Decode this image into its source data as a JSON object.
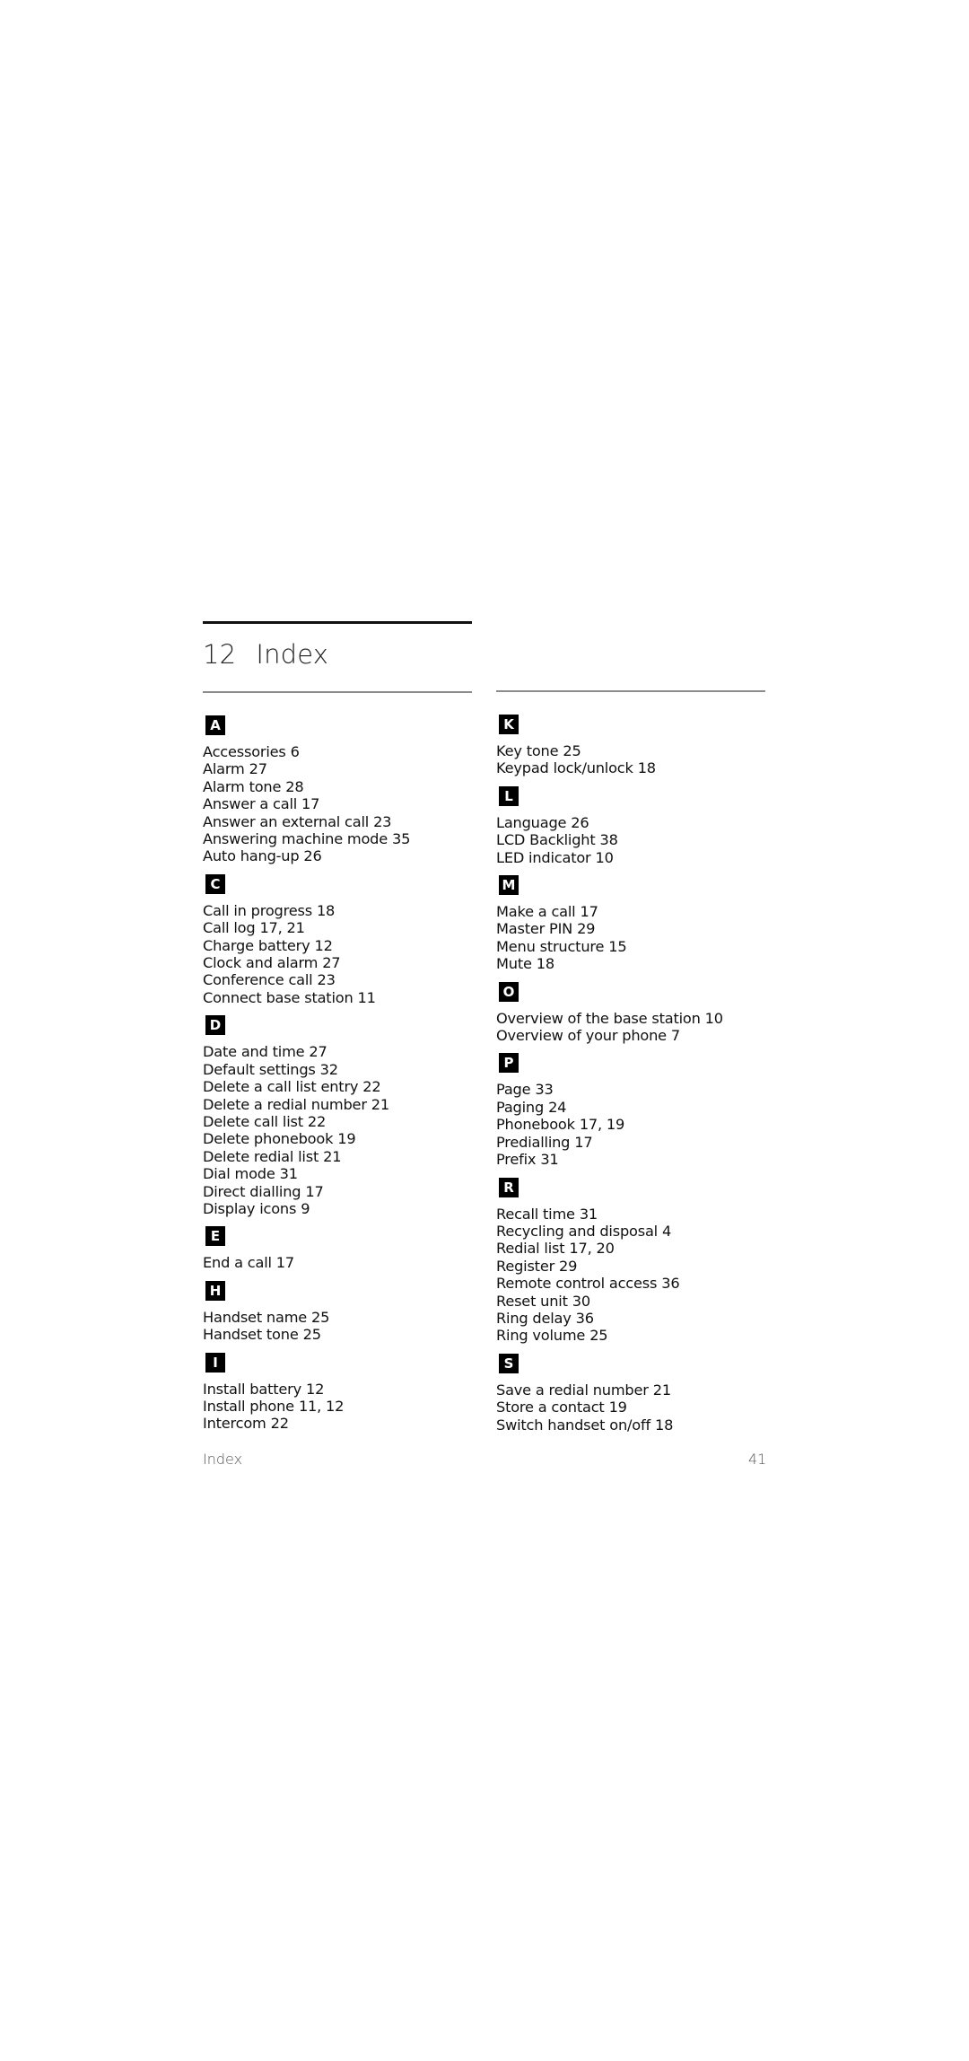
{
  "header": {
    "chapter_number": "12",
    "chapter_title": "Index"
  },
  "columns": [
    {
      "sections": [
        {
          "letter": "A",
          "entries": [
            {
              "term": "Accessories",
              "pages": "6"
            },
            {
              "term": "Alarm",
              "pages": "27"
            },
            {
              "term": "Alarm tone",
              "pages": "28"
            },
            {
              "term": "Answer a call",
              "pages": "17"
            },
            {
              "term": "Answer an external call",
              "pages": "23"
            },
            {
              "term": "Answering machine mode",
              "pages": "35"
            },
            {
              "term": "Auto hang-up",
              "pages": "26"
            }
          ]
        },
        {
          "letter": "C",
          "entries": [
            {
              "term": "Call in progress",
              "pages": "18"
            },
            {
              "term": "Call log",
              "pages": "17, 21"
            },
            {
              "term": "Charge battery",
              "pages": "12"
            },
            {
              "term": "Clock and alarm",
              "pages": "27"
            },
            {
              "term": "Conference call",
              "pages": "23"
            },
            {
              "term": "Connect base station",
              "pages": "11"
            }
          ]
        },
        {
          "letter": "D",
          "entries": [
            {
              "term": "Date and time",
              "pages": "27"
            },
            {
              "term": "Default settings",
              "pages": "32"
            },
            {
              "term": "Delete a call list entry",
              "pages": "22"
            },
            {
              "term": "Delete a redial number",
              "pages": "21"
            },
            {
              "term": "Delete call list",
              "pages": "22"
            },
            {
              "term": "Delete phonebook",
              "pages": "19"
            },
            {
              "term": "Delete redial list",
              "pages": "21"
            },
            {
              "term": "Dial mode",
              "pages": "31"
            },
            {
              "term": "Direct dialling",
              "pages": "17"
            },
            {
              "term": "Display icons",
              "pages": "9"
            }
          ]
        },
        {
          "letter": "E",
          "entries": [
            {
              "term": "End a call",
              "pages": "17"
            }
          ]
        },
        {
          "letter": "H",
          "entries": [
            {
              "term": "Handset name",
              "pages": "25"
            },
            {
              "term": "Handset tone",
              "pages": "25"
            }
          ]
        },
        {
          "letter": "I",
          "entries": [
            {
              "term": "Install battery",
              "pages": "12"
            },
            {
              "term": "Install phone",
              "pages": "11, 12"
            },
            {
              "term": "Intercom",
              "pages": "22"
            }
          ]
        }
      ]
    },
    {
      "sections": [
        {
          "letter": "K",
          "entries": [
            {
              "term": "Key tone",
              "pages": "25"
            },
            {
              "term": "Keypad lock/unlock",
              "pages": "18"
            }
          ]
        },
        {
          "letter": "L",
          "entries": [
            {
              "term": "Language",
              "pages": "26"
            },
            {
              "term": "LCD Backlight",
              "pages": "38"
            },
            {
              "term": "LED indicator",
              "pages": "10"
            }
          ]
        },
        {
          "letter": "M",
          "entries": [
            {
              "term": "Make a call",
              "pages": "17"
            },
            {
              "term": "Master PIN",
              "pages": "29"
            },
            {
              "term": "Menu structure",
              "pages": "15"
            },
            {
              "term": "Mute",
              "pages": "18"
            }
          ]
        },
        {
          "letter": "O",
          "entries": [
            {
              "term": "Overview of the base station",
              "pages": "10"
            },
            {
              "term": "Overview of your phone",
              "pages": "7"
            }
          ]
        },
        {
          "letter": "P",
          "entries": [
            {
              "term": "Page",
              "pages": "33"
            },
            {
              "term": "Paging",
              "pages": "24"
            },
            {
              "term": "Phonebook",
              "pages": "17, 19"
            },
            {
              "term": "Predialling",
              "pages": "17"
            },
            {
              "term": "Prefix",
              "pages": "31"
            }
          ]
        },
        {
          "letter": "R",
          "entries": [
            {
              "term": "Recall time",
              "pages": "31"
            },
            {
              "term": "Recycling and disposal",
              "pages": "4"
            },
            {
              "term": "Redial list",
              "pages": "17, 20"
            },
            {
              "term": "Register",
              "pages": "29"
            },
            {
              "term": "Remote control access",
              "pages": "36"
            },
            {
              "term": "Reset unit",
              "pages": "30"
            },
            {
              "term": "Ring delay",
              "pages": "36"
            },
            {
              "term": "Ring volume",
              "pages": "25"
            }
          ]
        },
        {
          "letter": "S",
          "entries": [
            {
              "term": "Save a redial number",
              "pages": "21"
            },
            {
              "term": "Store a contact",
              "pages": "19"
            },
            {
              "term": "Switch handset on/off",
              "pages": "18"
            }
          ]
        }
      ]
    }
  ],
  "footer": {
    "section_label": "Index",
    "page_number": "41"
  }
}
